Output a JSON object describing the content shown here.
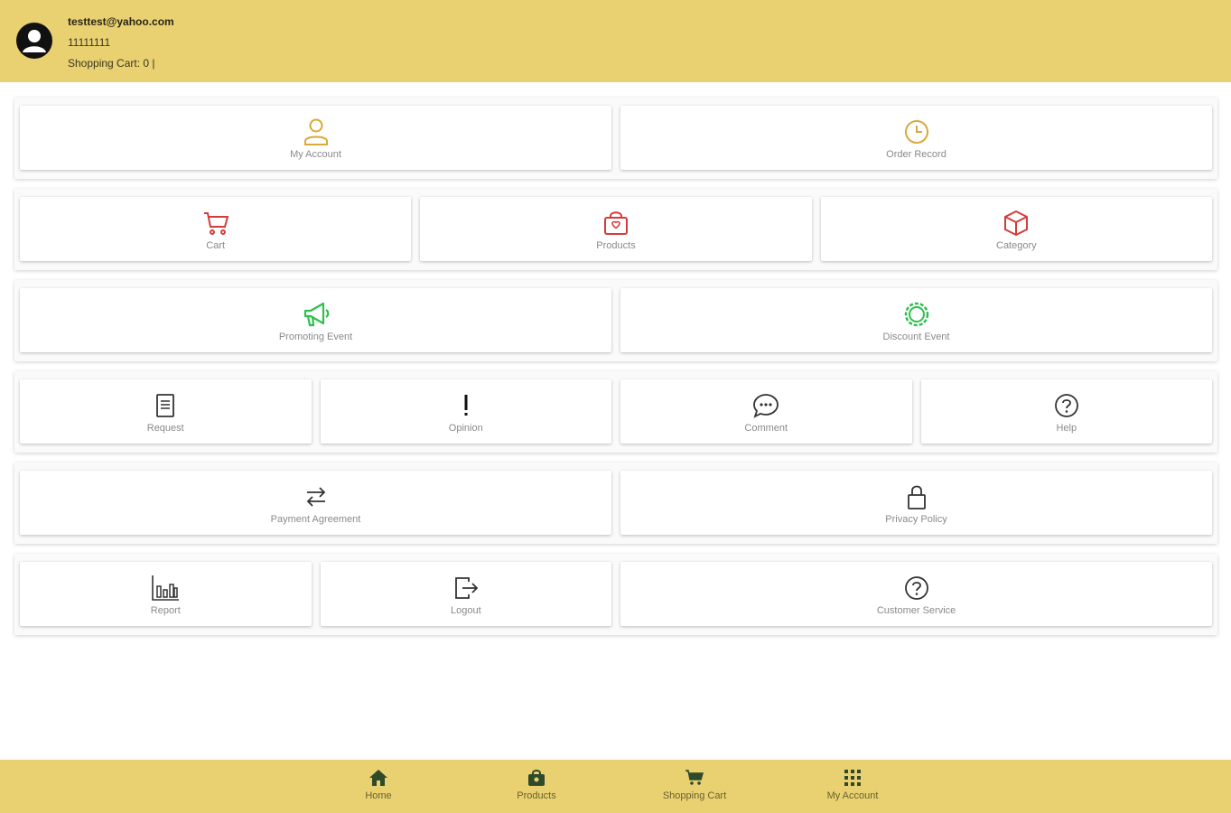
{
  "header": {
    "email": "testtest@yahoo.com",
    "phone": "11111111",
    "cart_status": "Shopping Cart: 0 |"
  },
  "colors": {
    "header_bg": "#e9d070",
    "gold_icon": "#d9a93a",
    "red_icon": "#d63b3b",
    "green_icon": "#2fbf4f",
    "dark_icon": "#333333"
  },
  "menu": {
    "my_account": "My Account",
    "order_record": "Order Record",
    "cart": "Cart",
    "products": "Products",
    "category": "Category",
    "promoting_event": "Promoting Event",
    "discount_event": "Discount Event",
    "request": "Request",
    "opinion": "Opinion",
    "comment": "Comment",
    "help": "Help",
    "payment_agreement": "Payment Agreement",
    "privacy_policy": "Privacy Policy",
    "report": "Report",
    "logout": "Logout",
    "customer_service": "Customer Service"
  },
  "nav": {
    "home": "Home",
    "products": "Products",
    "shopping_cart": "Shopping Cart",
    "my_account": "My Account"
  }
}
